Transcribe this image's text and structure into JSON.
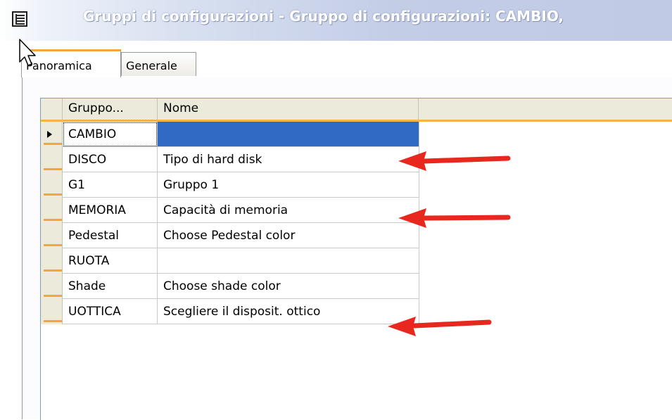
{
  "window": {
    "title": "Gruppi di configurazioni - Gruppo di configurazioni: CAMBIO,",
    "icon": "form-list-icon"
  },
  "tabs": [
    {
      "label": "Panoramica",
      "active": true
    },
    {
      "label": "Generale",
      "active": false
    }
  ],
  "grid": {
    "columns": [
      "Gruppo...",
      "Nome"
    ],
    "rows": [
      {
        "gruppo": "CAMBIO",
        "nome": "",
        "current": true
      },
      {
        "gruppo": "DISCO",
        "nome": "Tipo di hard disk"
      },
      {
        "gruppo": "G1",
        "nome": "Gruppo 1"
      },
      {
        "gruppo": "MEMORIA",
        "nome": "Capacità di memoria"
      },
      {
        "gruppo": "Pedestal",
        "nome": "Choose Pedestal color"
      },
      {
        "gruppo": "RUOTA",
        "nome": ""
      },
      {
        "gruppo": "Shade",
        "nome": "Choose shade color"
      },
      {
        "gruppo": "UOTTICA",
        "nome": "Scegliere il disposit. ottico"
      }
    ]
  },
  "annotations": {
    "arrow_color": "#e8281e",
    "arrow_targets": [
      "DISCO",
      "MEMORIA",
      "UOTTICA"
    ]
  },
  "colors": {
    "selection": "#316ac5",
    "header_accent": "#f3a63a",
    "header_bg": "#ebeadb"
  }
}
